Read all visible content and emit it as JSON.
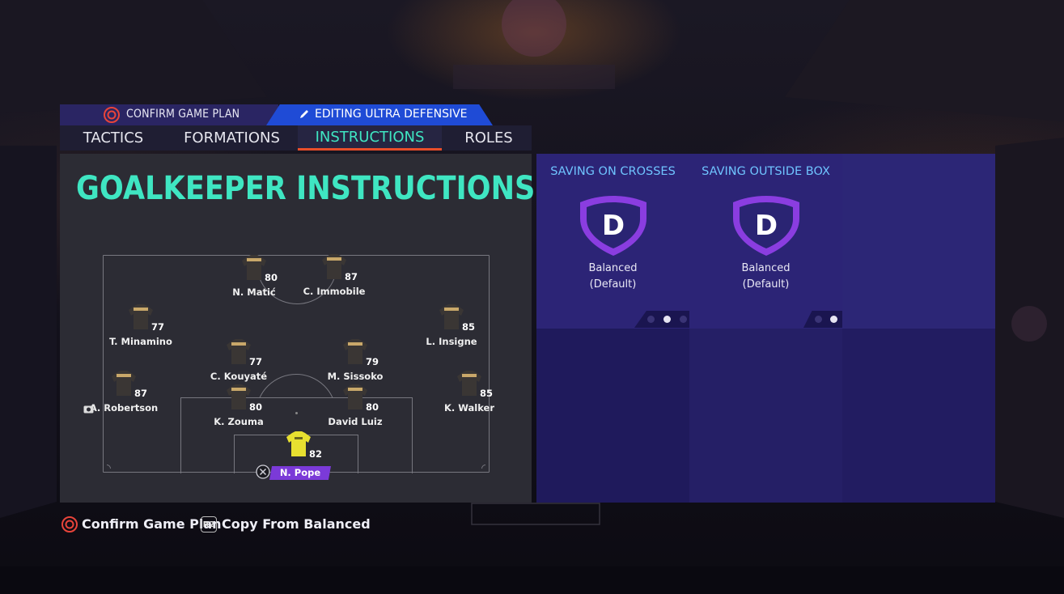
{
  "header": {
    "confirm_label": "CONFIRM GAME PLAN",
    "editing_label": "EDITING ULTRA DEFENSIVE"
  },
  "tabs": [
    {
      "label": "TACTICS",
      "active": false
    },
    {
      "label": "FORMATIONS",
      "active": false
    },
    {
      "label": "INSTRUCTIONS",
      "active": true
    },
    {
      "label": "ROLES",
      "active": false
    }
  ],
  "panel": {
    "title": "GOALKEEPER INSTRUCTIONS"
  },
  "players": [
    {
      "name": "N. Matić",
      "rating": "80"
    },
    {
      "name": "C. Immobile",
      "rating": "87"
    },
    {
      "name": "T. Minamino",
      "rating": "77"
    },
    {
      "name": "L. Insigne",
      "rating": "85"
    },
    {
      "name": "C. Kouyaté",
      "rating": "77"
    },
    {
      "name": "M. Sissoko",
      "rating": "79"
    },
    {
      "name": "A. Robertson",
      "rating": "87"
    },
    {
      "name": "K. Walker",
      "rating": "85"
    },
    {
      "name": "K. Zouma",
      "rating": "80"
    },
    {
      "name": "David Luiz",
      "rating": "80"
    },
    {
      "name": "N. Pope",
      "rating": "82"
    }
  ],
  "instructions": [
    {
      "title": "SAVING ON CROSSES",
      "badge_letter": "D",
      "value": "Balanced",
      "default_note": "(Default)",
      "dots": 3,
      "active_dot": 1
    },
    {
      "title": "SAVING OUTSIDE BOX",
      "badge_letter": "D",
      "value": "Balanced",
      "default_note": "(Default)",
      "dots": 2,
      "active_dot": 1
    }
  ],
  "footer": {
    "confirm": "Confirm Game Plan",
    "r2_key": "R2",
    "copy": "Copy From Balanced"
  },
  "colors": {
    "accent_teal": "#3fe6c2",
    "accent_blue_title": "#6fc4ff",
    "tab_underline": "#e84e2a",
    "badge_purple": "#7b3ad8",
    "panel_purple": "#2a2473",
    "gk_kit": "#e8e030"
  }
}
